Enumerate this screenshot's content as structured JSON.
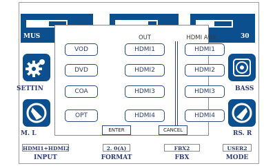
{
  "top_tiles": [
    {
      "label": "MUS",
      "bar_level": 0.55
    },
    {
      "label": "",
      "bar_level": 0.8
    },
    {
      "label": "30",
      "bar_level": 0.5
    }
  ],
  "side_labels": {
    "left_top": "SETTIN",
    "left_bottom": "M. L",
    "right_top": "BASS",
    "right_bottom": "RS. R"
  },
  "bottom_boxes": [
    {
      "value": "HDMI1+HDMI2",
      "label": "INPUT"
    },
    {
      "value": "2. 0(A)",
      "label": "FORMAT"
    },
    {
      "value": "FBX2",
      "label": "FBX"
    },
    {
      "value": "USER2",
      "label": "MODE"
    }
  ],
  "dialog": {
    "out_header": "OUT",
    "aux_header": "HDMI AUX",
    "sources": [
      "VOD",
      "DVD",
      "COA",
      "OPT"
    ],
    "out_options": [
      "HDMI1",
      "HDMI2",
      "HDMI3",
      "HDMI4"
    ],
    "aux_options": [
      "HDMI1",
      "HDMI2",
      "HDMI3",
      "HDMI4"
    ],
    "enter_label": "ENTER",
    "cancel_label": "CANCEL"
  },
  "colors": {
    "tile_blue": "#0b4f8e",
    "label_navy": "#2d3b78"
  },
  "icons": [
    "gear-icon",
    "speaker-icon"
  ]
}
